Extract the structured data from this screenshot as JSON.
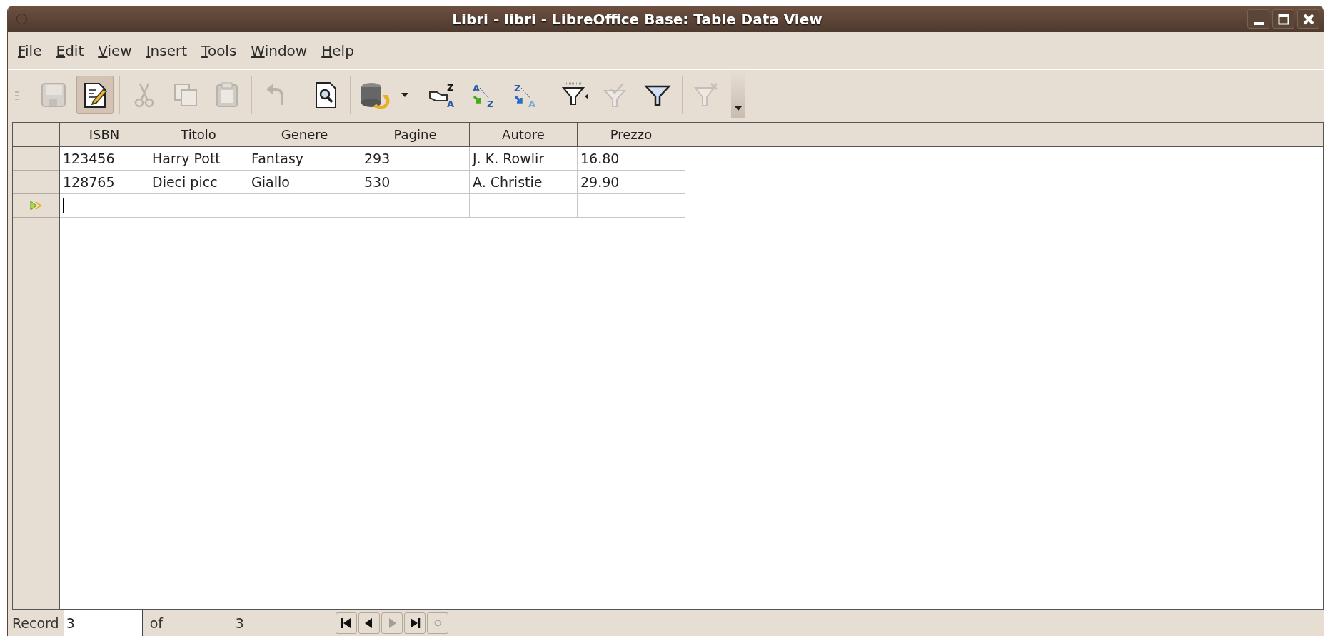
{
  "window": {
    "title": "Libri - libri - LibreOffice Base: Table Data View"
  },
  "menu": [
    {
      "label": "File"
    },
    {
      "label": "Edit"
    },
    {
      "label": "View"
    },
    {
      "label": "Insert"
    },
    {
      "label": "Tools"
    },
    {
      "label": "Window"
    },
    {
      "label": "Help"
    }
  ],
  "toolbar": [
    [
      {
        "kind": "save",
        "disabled": true,
        "selected": false
      },
      {
        "kind": "edit",
        "disabled": false,
        "selected": true
      }
    ],
    [
      {
        "kind": "cut",
        "disabled": true,
        "selected": false
      },
      {
        "kind": "copy",
        "disabled": true,
        "selected": false
      },
      {
        "kind": "paste",
        "disabled": true,
        "selected": false
      }
    ],
    [
      {
        "kind": "undo",
        "disabled": true,
        "selected": false
      }
    ],
    [
      {
        "kind": "find",
        "disabled": false,
        "selected": false
      }
    ],
    [
      {
        "kind": "database",
        "disabled": false,
        "selected": false
      },
      {
        "kind": "dropdown",
        "disabled": false,
        "selected": false
      }
    ],
    [
      {
        "kind": "sort",
        "disabled": false,
        "selected": false,
        "letters": [
          "Z",
          "A"
        ]
      },
      {
        "kind": "sort-asc",
        "disabled": false,
        "selected": false,
        "letters": [
          "A",
          "Z"
        ]
      },
      {
        "kind": "sort-desc",
        "disabled": false,
        "selected": false,
        "letters": [
          "Z",
          "A"
        ]
      }
    ],
    [
      {
        "kind": "autofilter",
        "disabled": false,
        "selected": false
      },
      {
        "kind": "apply-filter",
        "disabled": true,
        "selected": false
      },
      {
        "kind": "filter",
        "disabled": false,
        "selected": false
      }
    ],
    [
      {
        "kind": "remove-filter",
        "disabled": true,
        "selected": false
      }
    ]
  ],
  "table": {
    "columns": [
      "ISBN",
      "Titolo",
      "Genere",
      "Pagine",
      "Autore",
      "Prezzo"
    ],
    "rows": [
      {
        "current": false,
        "cells": [
          "123456",
          "Harry Pott",
          "Fantasy",
          "293",
          "J. K. Rowlir",
          "16.80"
        ]
      },
      {
        "current": false,
        "cells": [
          "128765",
          "Dieci picc",
          "Giallo",
          "530",
          "A. Christie",
          "29.90"
        ]
      }
    ],
    "new_row": {
      "current": true
    }
  },
  "status_bar": {
    "label": "Record",
    "value": "3",
    "of": "of",
    "total": "3",
    "nav": [
      {
        "kind": "first",
        "disabled": false
      },
      {
        "kind": "prev",
        "disabled": false
      },
      {
        "kind": "next",
        "disabled": true
      },
      {
        "kind": "last",
        "disabled": false
      },
      {
        "kind": "new",
        "disabled": true
      }
    ]
  }
}
